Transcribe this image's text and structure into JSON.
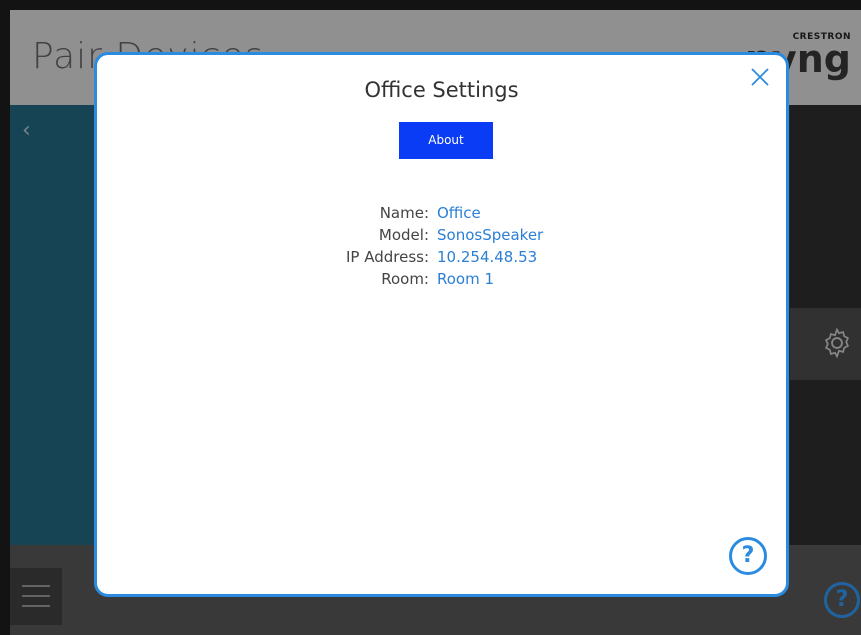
{
  "app": {
    "title": "Pair Devices",
    "brand_small": "CRESTRON",
    "brand_big": "pyng",
    "back_glyph": "‹",
    "help_glyph": "?"
  },
  "modal": {
    "title": "Office Settings",
    "tab_about": "About",
    "help_glyph": "?",
    "fields": [
      {
        "label": "Name:",
        "value": "Office"
      },
      {
        "label": "Model:",
        "value": "SonosSpeaker"
      },
      {
        "label": "IP Address:",
        "value": "10.254.48.53"
      },
      {
        "label": "Room:",
        "value": "Room 1"
      }
    ]
  },
  "icons": {
    "close": "close-icon",
    "help": "help-icon",
    "gear": "gear-icon",
    "menu": "hamburger-menu-icon",
    "back": "back-arrow-icon"
  },
  "colors": {
    "accent": "#2b8be0",
    "tab_active": "#0a3bf5",
    "value_text": "#2b7fd4"
  }
}
